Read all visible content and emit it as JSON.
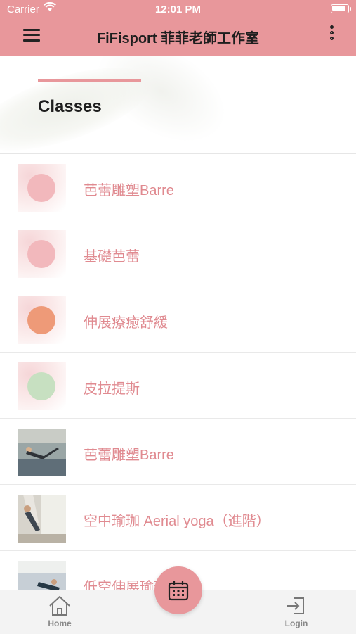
{
  "status_bar": {
    "carrier": "Carrier",
    "time": "12:01 PM"
  },
  "header": {
    "title": "FiFisport 菲菲老師工作室"
  },
  "banner": {
    "heading": "Classes"
  },
  "classes": [
    {
      "name": "芭蕾雕塑Barre",
      "thumb_kind": "circle",
      "thumb_color": "#f2b8bc"
    },
    {
      "name": "基礎芭蕾",
      "thumb_kind": "circle",
      "thumb_color": "#f2b8bc"
    },
    {
      "name": "伸展療癒舒緩",
      "thumb_kind": "circle",
      "thumb_color": "#ee9a78"
    },
    {
      "name": "皮拉提斯",
      "thumb_kind": "circle",
      "thumb_color": "#c7e0c1"
    },
    {
      "name": "芭蕾雕塑Barre",
      "thumb_kind": "photo"
    },
    {
      "name": "空中瑜珈 Aerial yoga（進階）",
      "thumb_kind": "photo"
    },
    {
      "name": "低空伸展瑜珈",
      "thumb_kind": "photo"
    }
  ],
  "bottom_nav": {
    "home_label": "Home",
    "login_label": "Login"
  },
  "icons": {
    "menu": "hamburger-menu-icon",
    "more": "more-vertical-icon",
    "home": "home-icon",
    "calendar": "calendar-icon",
    "login": "login-icon"
  },
  "colors": {
    "brand": "#e8979b",
    "label": "#e08a90"
  }
}
